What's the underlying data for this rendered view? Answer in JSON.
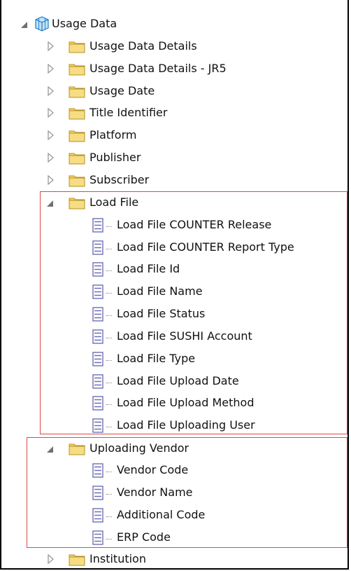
{
  "tree": {
    "root": {
      "label": "Usage Data",
      "icon": "cube-icon",
      "expanded": true
    },
    "folders_top": [
      {
        "label": "Usage Data Details",
        "expanded": false
      },
      {
        "label": "Usage Data Details - JR5",
        "expanded": false
      },
      {
        "label": "Usage Date",
        "expanded": false
      },
      {
        "label": "Title Identifier",
        "expanded": false
      },
      {
        "label": "Platform",
        "expanded": false
      },
      {
        "label": "Publisher",
        "expanded": false
      },
      {
        "label": "Subscriber",
        "expanded": false
      }
    ],
    "load_file": {
      "label": "Load File",
      "expanded": true,
      "columns": [
        "Load File COUNTER Release",
        "Load File COUNTER Report Type",
        "Load File Id",
        "Load File Name",
        "Load File Status",
        "Load File SUSHI Account",
        "Load File Type",
        "Load File Upload Date",
        "Load File Upload Method",
        "Load File Uploading User"
      ]
    },
    "uploading_vendor": {
      "label": "Uploading Vendor",
      "expanded": true,
      "columns": [
        "Vendor Code",
        "Vendor Name",
        "Additional Code",
        "ERP Code"
      ]
    },
    "institution": {
      "label": "Institution",
      "expanded": false
    }
  },
  "colors": {
    "highlight_box": "#e04848",
    "folder_fill": "#f3d36b",
    "folder_edge": "#b8901f",
    "expander_expanded": "#707070",
    "expander_collapsed": "#9a9a9a",
    "column_icon": "#6f6fb5"
  }
}
